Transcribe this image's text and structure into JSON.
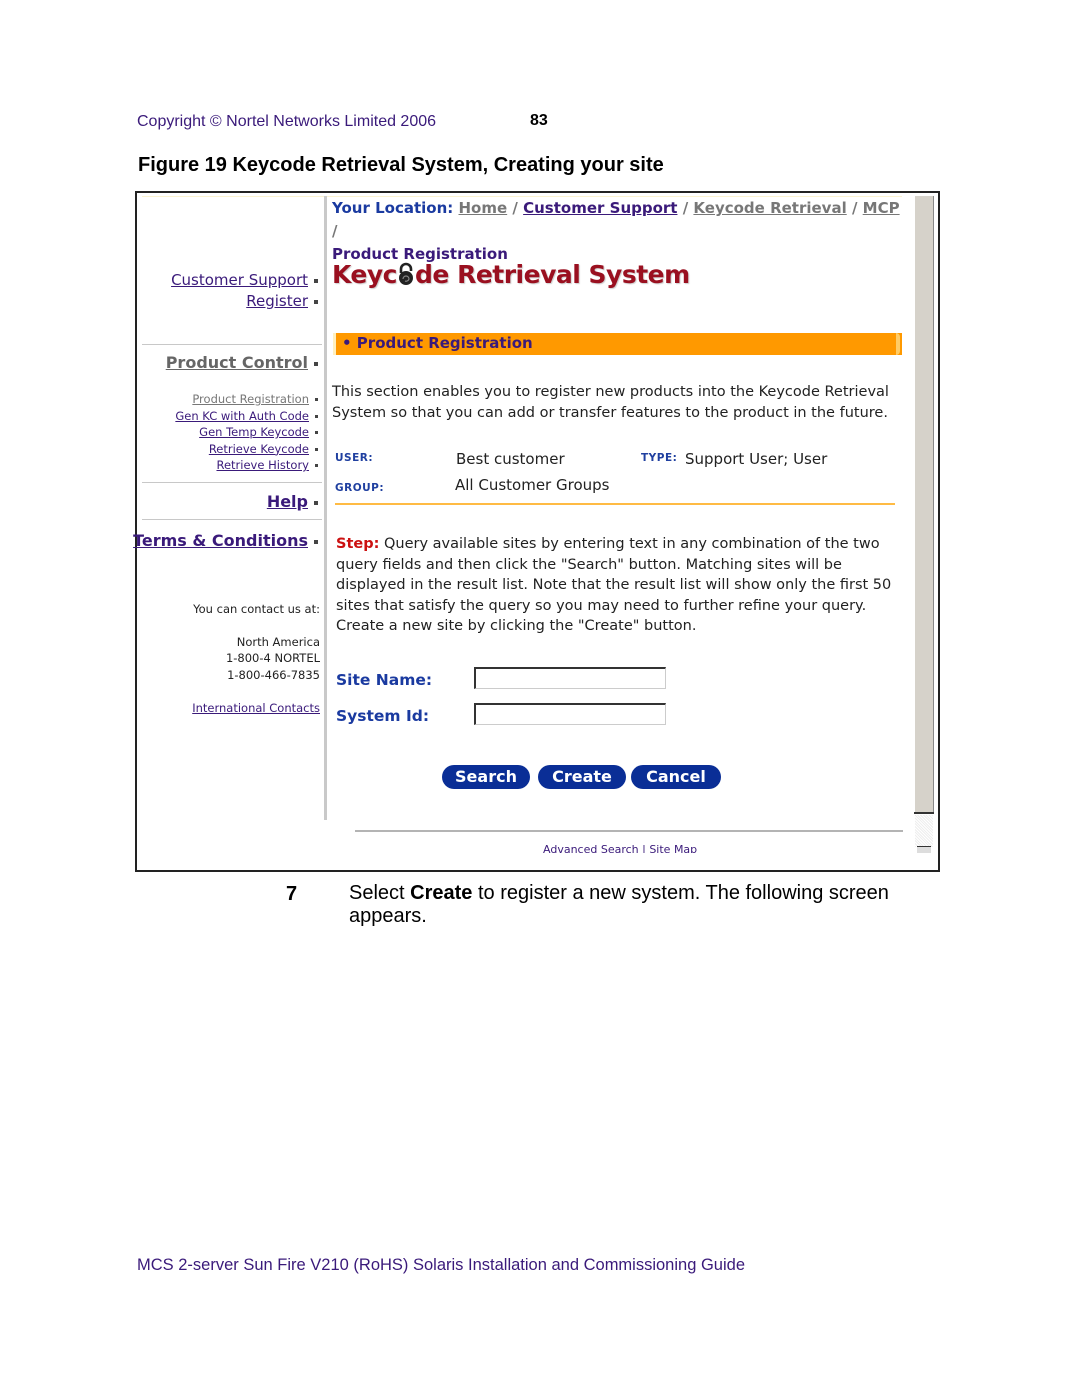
{
  "header": {
    "copyright": "Copyright © Nortel Networks Limited 2006",
    "page_number": "83"
  },
  "figure": {
    "title": "Figure 19  Keycode Retrieval System, Creating your site"
  },
  "screenshot": {
    "left_nav": {
      "top_links": [
        {
          "label": "Customer Support"
        },
        {
          "label": "Register"
        }
      ],
      "product_control": {
        "heading": "Product Control",
        "items": [
          {
            "label": "Product Registration"
          },
          {
            "label": "Gen KC with Auth Code"
          },
          {
            "label": "Gen Temp Keycode"
          },
          {
            "label": "Retrieve Keycode"
          },
          {
            "label": "Retrieve History"
          }
        ]
      },
      "help": "Help",
      "terms": "Terms & Conditions",
      "contact": {
        "intro": "You can contact us at:",
        "region": "North America",
        "phone1": "1-800-4 NORTEL",
        "phone2": "1-800-466-7835",
        "international": "International Contacts"
      }
    },
    "breadcrumb": {
      "prefix": "Your Location:",
      "items": [
        "Home",
        "Customer Support",
        "Keycode Retrieval",
        "MCP"
      ],
      "separator": "/",
      "current": "Product Registration"
    },
    "brand": {
      "before": "Keyc",
      "icon": "padlock-icon",
      "after": "de Retrieval System"
    },
    "section_banner": "• Product Registration",
    "intro": "This section enables you to register new products into the Keycode Retrieval System so that you can add or transfer features to the product in the future.",
    "user_info": {
      "user_label": "USER:",
      "user_value": "Best customer",
      "type_label": "TYPE:",
      "type_value": "Support User; User",
      "group_label": "GROUP:",
      "group_value": "All Customer Groups"
    },
    "step": {
      "label": "Step:",
      "text": " Query available sites by entering text in any combination of the two query fields and then click the \"Search\" button. Matching sites will be displayed in the result list. Note that the result list will show only the first 50 sites that satisfy the query so you may need to further refine your query. Create a new site by clicking the \"Create\" button."
    },
    "form": {
      "site_name_label": "Site Name:",
      "site_name_value": "",
      "system_id_label": "System Id:",
      "system_id_value": ""
    },
    "buttons": {
      "search": "Search",
      "create": "Create",
      "cancel": "Cancel"
    },
    "footer_links": {
      "advanced_search": "Advanced Search",
      "divider": " | ",
      "site_map": "Site Map"
    },
    "colors": {
      "accent_orange": "#ff9900",
      "button_blue": "#0a2e96",
      "brand_red": "#9a1020",
      "link_purple": "#3a1a7a"
    }
  },
  "instruction": {
    "number": "7",
    "pre": "Select ",
    "bold": "Create",
    "post": " to register a new system. The following screen appears."
  },
  "footer": {
    "doc_title": "MCS 2-server Sun Fire V210 (RoHS) Solaris Installation and Commissioning Guide"
  }
}
